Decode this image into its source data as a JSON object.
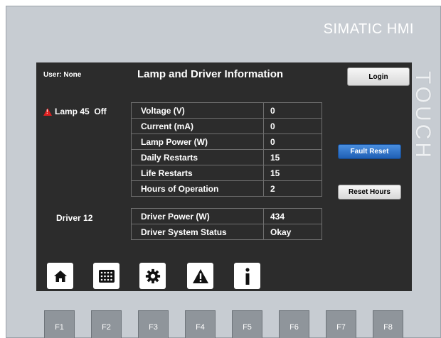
{
  "brand": "SIMATIC HMI",
  "touch_label": "TOUCH",
  "header": {
    "user": "User: None",
    "title": "Lamp and Driver Information",
    "login_label": "Login"
  },
  "lamp": {
    "status": "Lamp 45  Off",
    "icon": "warning-icon"
  },
  "driver": {
    "label": "Driver 12"
  },
  "lamp_table": [
    {
      "label": "Voltage (V)",
      "value": "0"
    },
    {
      "label": "Current (mA)",
      "value": "0"
    },
    {
      "label": "Lamp Power (W)",
      "value": "0"
    },
    {
      "label": "Daily Restarts",
      "value": "15"
    },
    {
      "label": "Life Restarts",
      "value": "15"
    },
    {
      "label": "Hours of Operation",
      "value": "2"
    }
  ],
  "driver_table": [
    {
      "label": "Driver Power (W)",
      "value": "434"
    },
    {
      "label": "Driver System Status",
      "value": "Okay"
    }
  ],
  "buttons": {
    "fault_reset": "Fault Reset",
    "reset_hours": "Reset Hours"
  },
  "nav_icons": [
    "home-icon",
    "keypad-icon",
    "settings-icon",
    "alarm-icon",
    "info-icon"
  ],
  "function_keys": [
    "F1",
    "F2",
    "F3",
    "F4",
    "F5",
    "F6",
    "F7",
    "F8"
  ],
  "colors": {
    "screen_bg": "#2c2c2c",
    "bezel": "#c7ccd2",
    "accent_blue": "#1f5fb4",
    "alarm_red": "#e02020"
  }
}
